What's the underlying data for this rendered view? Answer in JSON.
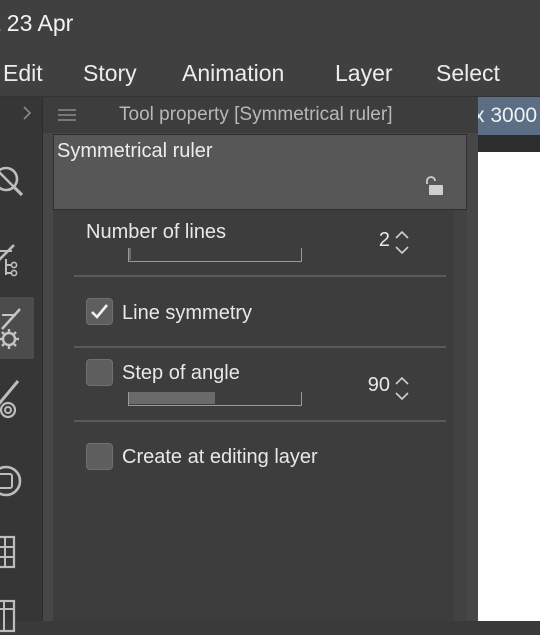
{
  "status": {
    "time": "t 23 Apr"
  },
  "menu": {
    "items": [
      {
        "label": "Edit"
      },
      {
        "label": "Story"
      },
      {
        "label": "Animation"
      },
      {
        "label": "Layer"
      },
      {
        "label": "Select"
      }
    ]
  },
  "canvas": {
    "tab_label": "x 3000"
  },
  "panel": {
    "title": "Tool property [Symmetrical ruler]",
    "preset_name": "Symmetrical ruler",
    "number_of_lines": {
      "label": "Number of lines",
      "value": "2",
      "fill_fraction": 0.01
    },
    "line_symmetry": {
      "label": "Line symmetry",
      "checked": true
    },
    "step_of_angle": {
      "label": "Step of angle",
      "checked": false,
      "value": "90",
      "fill_fraction": 0.5
    },
    "create_at_editing_layer": {
      "label": "Create at editing layer",
      "checked": false
    }
  },
  "icons": {
    "tools": [
      "ruler-search-icon",
      "ruler-link-icon",
      "ruler-gear-icon",
      "ruler-pen-icon",
      "circle-icon",
      "grid-icon",
      "film-icon"
    ],
    "lock": "unlock-icon",
    "menu": "hamburger-icon",
    "expand": "chevron-right-icon"
  },
  "colors": {
    "panel_bg": "#474747",
    "body_bg": "#3d3d3d",
    "canvas_tab": "#5c6e84",
    "text": "#e8e8e8"
  }
}
